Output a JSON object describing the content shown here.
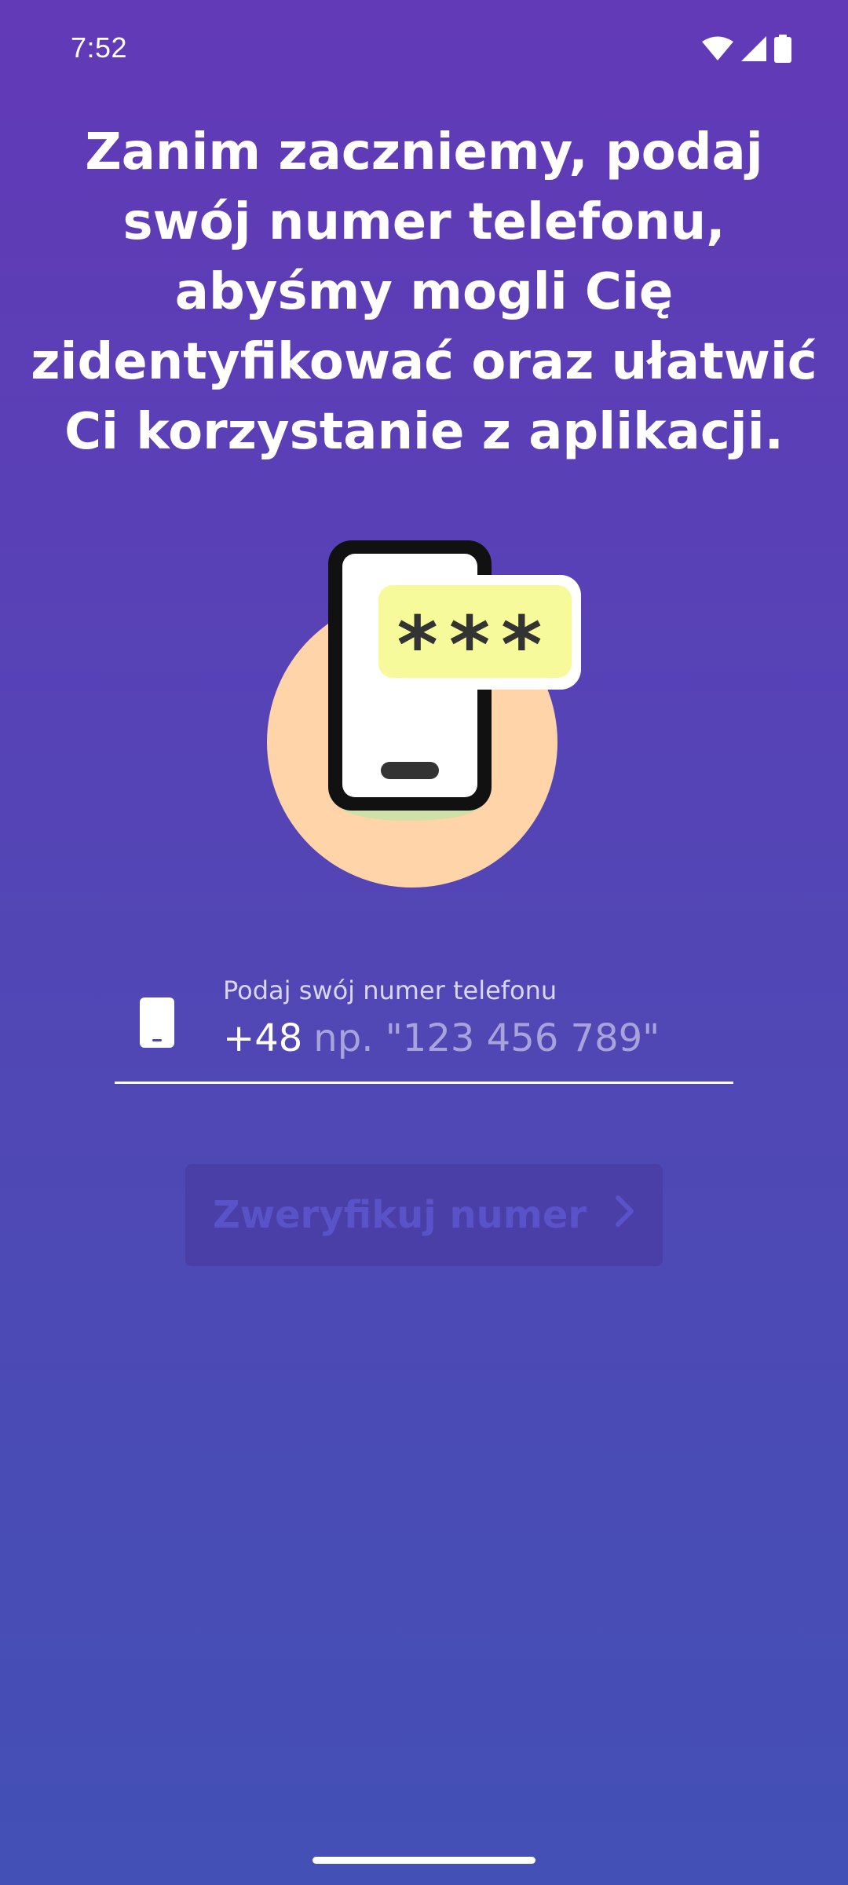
{
  "status_bar": {
    "time": "7:52",
    "icons": [
      "wifi-icon",
      "cellular-signal-icon",
      "battery-icon"
    ]
  },
  "heading": "Zanim zaczniemy, podaj swój numer telefonu, abyśmy mogli Cię zidentyfikować oraz ułatwić Ci korzystanie z aplikacji.",
  "illustration": {
    "icon": "phone-password-illustration",
    "code_text": "***"
  },
  "phone_input": {
    "icon": "phone-icon",
    "label": "Podaj swój numer telefonu",
    "prefix": "+48",
    "value": "",
    "placeholder": "np. \"123 456 789\""
  },
  "verify_button": {
    "label": "Zweryfikuj numer",
    "icon": "chevron-right-icon",
    "enabled": false
  },
  "colors": {
    "background_top": "#6239b7",
    "background_bottom": "#4350b5",
    "circle": "#ffd4a8",
    "code_bubble": "#f7fa9a",
    "button_bg_disabled": "#4a3fa6",
    "button_text_disabled": "#5a52c8"
  }
}
